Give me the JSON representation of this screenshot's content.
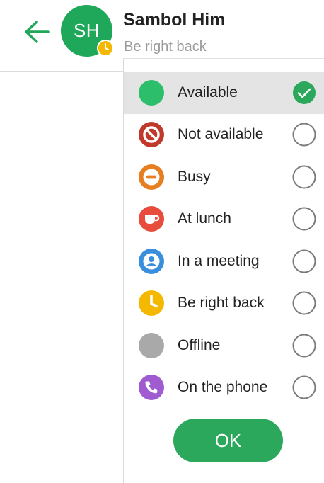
{
  "header": {
    "contact_name": "Sambol Him",
    "contact_status": "Be right back",
    "avatar_initials": "SH",
    "avatar_color": "#1fa85a",
    "back_icon": "arrow-left-icon",
    "avatar_status_icon": "clock-icon"
  },
  "status_menu": {
    "items": [
      {
        "label": "Available",
        "icon": "available-dot-icon",
        "color": "#2dbe6c",
        "selected": true
      },
      {
        "label": "Not available",
        "icon": "not-available-icon",
        "color": "#c0392b",
        "selected": false
      },
      {
        "label": "Busy",
        "icon": "busy-icon",
        "color": "#e67e22",
        "selected": false
      },
      {
        "label": "At lunch",
        "icon": "cup-icon",
        "color": "#e74c3c",
        "selected": false
      },
      {
        "label": "In a meeting",
        "icon": "person-icon",
        "color": "#3a8fdc",
        "selected": false
      },
      {
        "label": "Be right back",
        "icon": "clock-icon",
        "color": "#f5b800",
        "selected": false
      },
      {
        "label": "Offline",
        "icon": "offline-dot-icon",
        "color": "#a9a9a9",
        "selected": false
      },
      {
        "label": "On the phone",
        "icon": "phone-icon",
        "color": "#a05bd0",
        "selected": false
      }
    ],
    "ok_label": "OK",
    "accent_color": "#2ba85c"
  }
}
